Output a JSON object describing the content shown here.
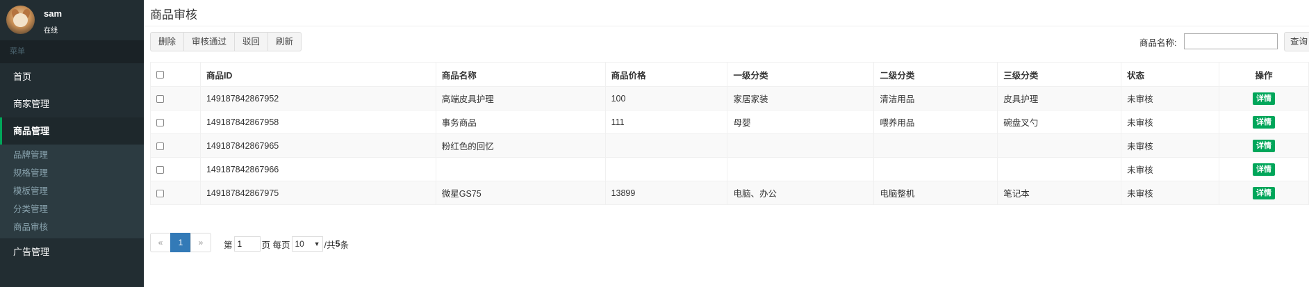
{
  "sidebar": {
    "user": {
      "name": "sam",
      "status": "在线"
    },
    "menu_header": "菜单",
    "items_top": [
      "首页",
      "商家管理"
    ],
    "active_item": "商品管理",
    "submenu": [
      "品牌管理",
      "规格管理",
      "模板管理",
      "分类管理",
      "商品审核"
    ],
    "items_bottom": [
      "广告管理"
    ]
  },
  "page": {
    "title": "商品审核"
  },
  "toolbar": {
    "delete": "删除",
    "approve": "审核通过",
    "reject": "驳回",
    "refresh": "刷新"
  },
  "search": {
    "label": "商品名称:",
    "value": "",
    "button": "查询"
  },
  "table": {
    "headers": [
      "商品ID",
      "商品名称",
      "商品价格",
      "一级分类",
      "二级分类",
      "三级分类",
      "状态",
      "操作"
    ],
    "rows": [
      {
        "id": "149187842867952",
        "name": "高端皮具护理",
        "price": "100",
        "cat1": "家居家装",
        "cat2": "清洁用品",
        "cat3": "皮具护理",
        "status": "未审核",
        "action": "详情"
      },
      {
        "id": "149187842867958",
        "name": "事务商品",
        "price": "111",
        "cat1": "母婴",
        "cat2": "喂养用品",
        "cat3": "碗盘叉勺",
        "status": "未审核",
        "action": "详情"
      },
      {
        "id": "149187842867965",
        "name": "粉红色的回忆",
        "price": "",
        "cat1": "",
        "cat2": "",
        "cat3": "",
        "status": "未审核",
        "action": "详情"
      },
      {
        "id": "149187842867966",
        "name": "",
        "price": "",
        "cat1": "",
        "cat2": "",
        "cat3": "",
        "status": "未审核",
        "action": "详情"
      },
      {
        "id": "149187842867975",
        "name": "微星GS75",
        "price": "13899",
        "cat1": "电脑、办公",
        "cat2": "电脑整机",
        "cat3": "笔记本",
        "status": "未审核",
        "action": "详情"
      }
    ]
  },
  "pagination": {
    "prev": "«",
    "current": "1",
    "next": "»",
    "page_prefix": "第",
    "page_value": "1",
    "page_suffix": "页 每页",
    "per_page": "10",
    "total_prefix": "/共",
    "total": "5",
    "total_suffix": "条"
  },
  "colors": {
    "sidebar_bg": "#222d32",
    "active_border": "#00a65a",
    "detail_btn": "#00a65a",
    "page_active": "#337ab7"
  }
}
